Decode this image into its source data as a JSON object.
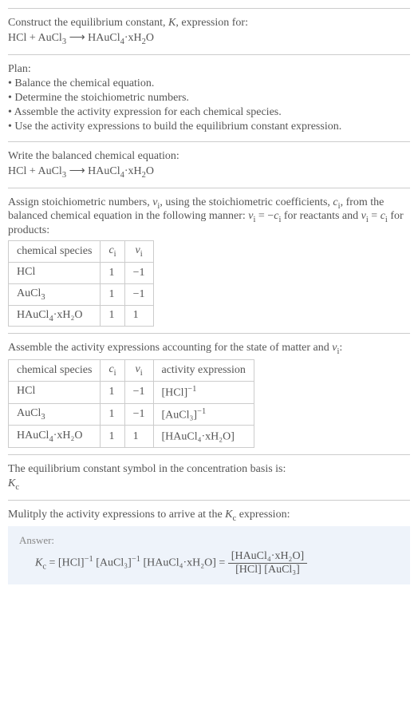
{
  "header": {
    "line1_prefix": "Construct the equilibrium constant, ",
    "line1_ital": "K",
    "line1_suffix": ", expression for:",
    "arrow": "⟶"
  },
  "reaction": {
    "lhs_1": "HCl",
    "plus": " + ",
    "lhs_2": "AuCl",
    "lhs_2_sub": "3",
    "arrow_sp": "  ⟶  ",
    "rhs": "HAuCl",
    "rhs_sub": "4",
    "rhs_mid": "·xH",
    "rhs_sub2": "2",
    "rhs_end": "O"
  },
  "plan": {
    "title": "Plan:",
    "bullets": [
      "• Balance the chemical equation.",
      "• Determine the stoichiometric numbers.",
      "• Assemble the activity expression for each chemical species.",
      "• Use the activity expressions to build the equilibrium constant expression."
    ]
  },
  "balanced_title": "Write the balanced chemical equation:",
  "assign": {
    "part1": "Assign stoichiometric numbers, ",
    "nu": "ν",
    "i_sub": "i",
    "part2": ", using the stoichiometric coefficients, ",
    "c": "c",
    "part3": ", from the balanced chemical equation in the following manner: ",
    "eq1": " = −",
    "part4": " for reactants and ",
    "eq2": " = ",
    "part5": " for products:"
  },
  "table1": {
    "h1": "chemical species",
    "rows": [
      {
        "sp": "HCl",
        "sp_sub": "",
        "tail": "",
        "c": "1",
        "v": "−1"
      },
      {
        "sp": "AuCl",
        "sp_sub": "3",
        "tail": "",
        "c": "1",
        "v": "−1"
      },
      {
        "sp": "HAuCl",
        "sp_sub": "4",
        "tail": "·xH₂O",
        "c": "1",
        "v": "1"
      }
    ]
  },
  "table2": {
    "intro_prefix": "Assemble the activity expressions accounting for the state of matter and ",
    "intro_suffix": ":",
    "h_act": "activity expression",
    "rows": [
      {
        "sp": "HCl",
        "sp_sub": "",
        "tail": "",
        "c": "1",
        "v": "−1",
        "act": "[HCl]",
        "act_sup": "−1"
      },
      {
        "sp": "AuCl",
        "sp_sub": "3",
        "tail": "",
        "c": "1",
        "v": "−1",
        "act": "[AuCl₃]",
        "act_sup": "−1"
      },
      {
        "sp": "HAuCl",
        "sp_sub": "4",
        "tail": "·xH₂O",
        "c": "1",
        "v": "1",
        "act": "[HAuCl₄·xH₂O]",
        "act_sup": ""
      }
    ]
  },
  "basis": {
    "line": "The equilibrium constant symbol in the concentration basis is:",
    "sym": "K",
    "sym_sub": "c"
  },
  "multiply": {
    "line_prefix": "Mulitply the activity expressions to arrive at the ",
    "line_suffix": " expression:"
  },
  "answer": {
    "label": "Answer:",
    "Kc": "K",
    "Kc_sub": "c",
    "eq": " = ",
    "t1": "[HCl]",
    "sup_m1": "−1",
    "t2": " [AuCl₃]",
    "t3": " [HAuCl₄·xH₂O] = ",
    "num": "[HAuCl₄·xH₂O]",
    "den": "[HCl] [AuCl₃]"
  }
}
